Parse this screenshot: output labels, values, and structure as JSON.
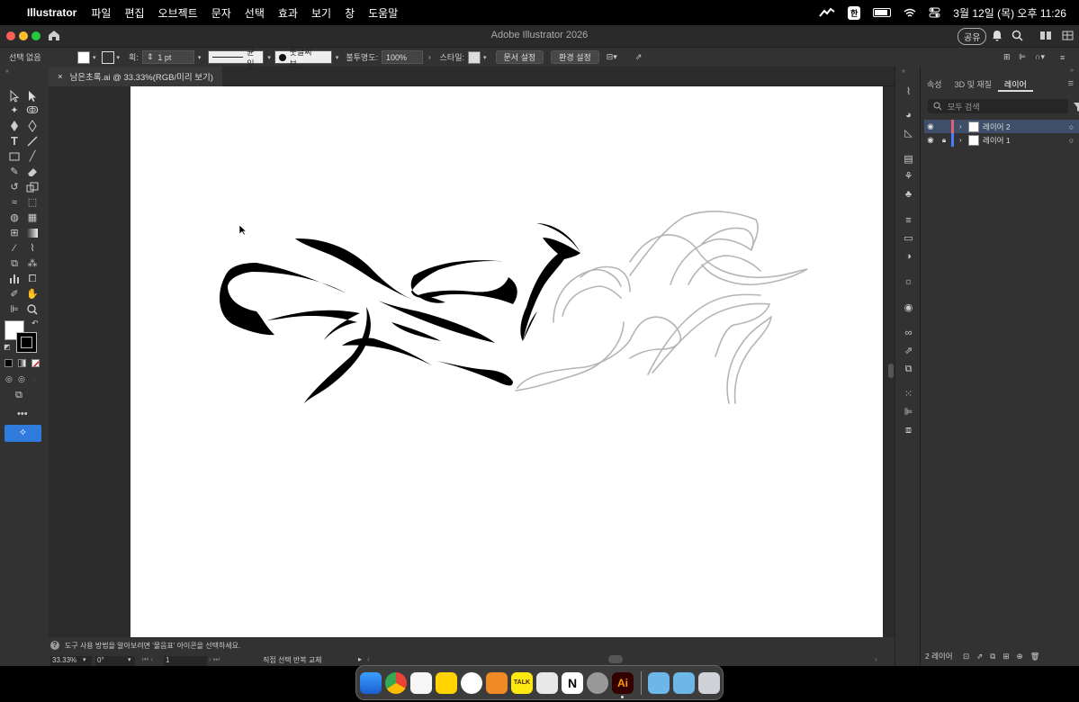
{
  "menubar": {
    "app_name": "Illustrator",
    "items": [
      "파일",
      "편집",
      "오브젝트",
      "문자",
      "선택",
      "효과",
      "보기",
      "창",
      "도움말"
    ],
    "input_method": "한",
    "clock": "3월 12일 (목) 오후 11:26"
  },
  "window": {
    "title": "Adobe Illustrator 2026",
    "share_label": "공유"
  },
  "control_bar": {
    "selection_status": "선택 없음",
    "stroke_label": "획:",
    "stroke_weight": "1 pt",
    "stroke_profile": "균일",
    "brush": "붓글씨 브...",
    "opacity_label": "불투명도:",
    "opacity": "100%",
    "style_label": "스타일:",
    "doc_setup": "문서 설정",
    "preferences": "환경 설정"
  },
  "document": {
    "tab_title": "남은초록.ai @ 33.33%(RGB/미리 보기)",
    "close_glyph": "×"
  },
  "status": {
    "hint": "도구 사용 방법을 알아보려면 '물음표' 아이콘을 선택하세요.",
    "zoom": "33.33%",
    "rotation": "0°",
    "artboard": "1",
    "mode": "직접 선택 반복 교체"
  },
  "layers_panel": {
    "tabs": [
      "속성",
      "3D 및 재질",
      "레이어"
    ],
    "active_tab": "레이어",
    "search_placeholder": "모두 검색",
    "layers": [
      {
        "name": "레이어 2",
        "color": "#e0607a",
        "selected": true,
        "locked": false
      },
      {
        "name": "레이어 1",
        "color": "#4a7cff",
        "selected": false,
        "locked": true
      }
    ],
    "layer_count": "2 레이어"
  },
  "colors": {
    "accent": "#2f7bdb",
    "panel": "#323232",
    "canvas": "#2b2b2b"
  },
  "dock": {
    "ai_label": "Ai",
    "talk_label": "TALK"
  }
}
